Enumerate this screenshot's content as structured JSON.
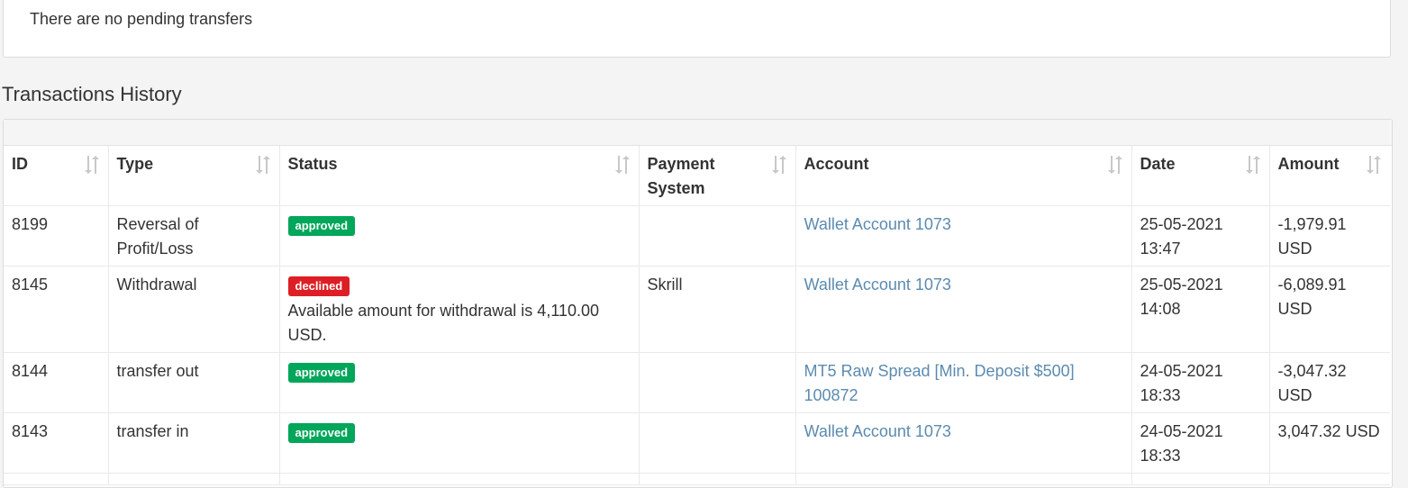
{
  "pending": {
    "message": "There are no pending transfers"
  },
  "section_title": "Transactions History",
  "table": {
    "columns": [
      {
        "key": "id",
        "label": "ID"
      },
      {
        "key": "type",
        "label": "Type"
      },
      {
        "key": "status",
        "label": "Status"
      },
      {
        "key": "payment_system",
        "label": "Payment System"
      },
      {
        "key": "account",
        "label": "Account"
      },
      {
        "key": "date",
        "label": "Date"
      },
      {
        "key": "amount",
        "label": "Amount"
      }
    ],
    "rows": [
      {
        "id": "8199",
        "type": "Reversal of Profit/Loss",
        "status": "approved",
        "status_note": "",
        "payment_system": "",
        "account": "Wallet Account 1073",
        "date": "25-05-2021 13:47",
        "amount": "-1,979.91 USD"
      },
      {
        "id": "8145",
        "type": "Withdrawal",
        "status": "declined",
        "status_note": "Available amount for withdrawal is 4,110.00 USD.",
        "payment_system": "Skrill",
        "account": "Wallet Account 1073",
        "date": "25-05-2021 14:08",
        "amount": "-6,089.91 USD"
      },
      {
        "id": "8144",
        "type": "transfer out",
        "status": "approved",
        "status_note": "",
        "payment_system": "",
        "account": "MT5 Raw Spread [Min. Deposit $500] 100872",
        "date": "24-05-2021 18:33",
        "amount": "-3,047.32 USD"
      },
      {
        "id": "8143",
        "type": "transfer in",
        "status": "approved",
        "status_note": "",
        "payment_system": "",
        "account": "Wallet Account 1073",
        "date": "24-05-2021 18:33",
        "amount": "3,047.32 USD"
      },
      {
        "id": "",
        "type": "",
        "status": "",
        "status_note": "",
        "payment_system": "",
        "account": "",
        "date": "",
        "amount": ""
      }
    ]
  },
  "colors": {
    "approved": "#00a65a",
    "declined": "#dd1e24",
    "link": "#5b8bb0",
    "sort_icon": "#c8c8c8"
  },
  "icons": {
    "sort": "sort-icon"
  }
}
